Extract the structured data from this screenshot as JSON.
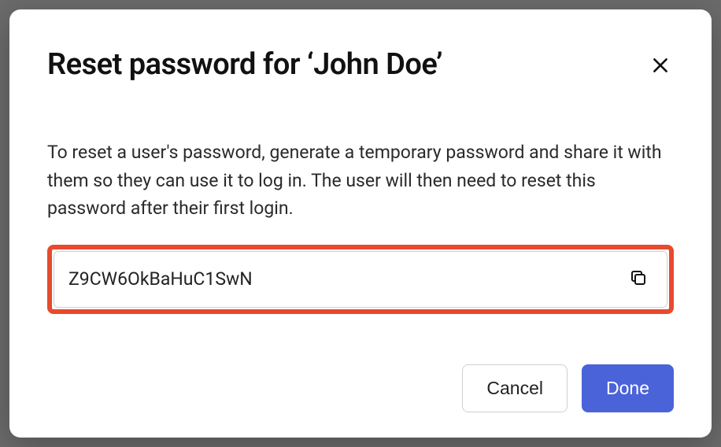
{
  "modal": {
    "title": "Reset password for ‘John Doe’",
    "description": "To reset a user's password, generate a temporary password and share it with them so they can use it to log in. The user will then need to reset this password after their first login.",
    "generated_password": "Z9CW6OkBaHuC1SwN",
    "buttons": {
      "cancel": "Cancel",
      "done": "Done"
    }
  }
}
